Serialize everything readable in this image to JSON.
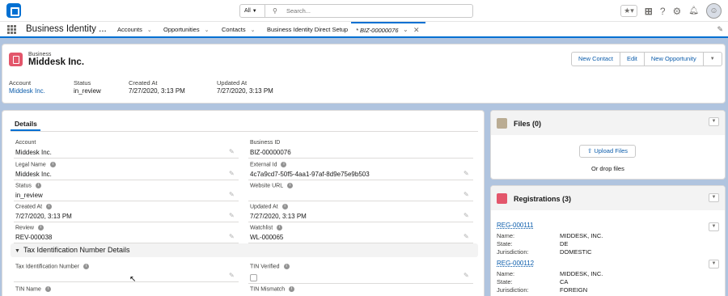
{
  "header": {
    "search_scope": "All",
    "search_placeholder": "Search..."
  },
  "nav": {
    "app_name": "Business Identity ...",
    "items": [
      {
        "label": "Accounts"
      },
      {
        "label": "Opportunities"
      },
      {
        "label": "Contacts"
      },
      {
        "label": "Business Identity Direct Setup"
      }
    ],
    "active_tab": "* BIZ-00000076"
  },
  "record": {
    "object_label": "Business",
    "name": "Middesk Inc.",
    "actions": [
      "New Contact",
      "Edit",
      "New Opportunity"
    ],
    "highlights": [
      {
        "label": "Account",
        "value": "Middesk Inc."
      },
      {
        "label": "Status",
        "value": "in_review"
      },
      {
        "label": "Created At",
        "value": "7/27/2020, 3:13 PM"
      },
      {
        "label": "Updated At",
        "value": "7/27/2020, 3:13 PM"
      }
    ]
  },
  "details": {
    "tab_label": "Details",
    "fields": [
      {
        "label": "Account",
        "value": "Middesk Inc."
      },
      {
        "label": "Business ID",
        "value": "BIZ-00000076"
      },
      {
        "label": "Legal Name",
        "value": "Middesk Inc."
      },
      {
        "label": "External Id",
        "value": "4c7a9cd7-50f5-4aa1-97af-8d9e75e9b503"
      },
      {
        "label": "Status",
        "value": "in_review"
      },
      {
        "label": "Website URL",
        "value": ""
      },
      {
        "label": "Created At",
        "value": "7/27/2020, 3:13 PM"
      },
      {
        "label": "Updated At",
        "value": "7/27/2020, 3:13 PM"
      },
      {
        "label": "Review",
        "value": "REV-000038"
      },
      {
        "label": "Watchlist",
        "value": "WL-000065"
      }
    ],
    "section_title": "Tax Identification Number Details",
    "tin_fields": [
      {
        "label": "Tax Identification Number"
      },
      {
        "label": "TIN Verified"
      },
      {
        "label": "TIN Name"
      },
      {
        "label": "TIN Mismatch"
      }
    ]
  },
  "files": {
    "title": "Files (0)",
    "upload_label": "Upload Files",
    "drop_label": "Or drop files"
  },
  "registrations": {
    "title": "Registrations (3)",
    "field_labels": {
      "name": "Name:",
      "state": "State:",
      "jurisdiction": "Jurisdiction:"
    },
    "items": [
      {
        "id": "REG-000111",
        "name": "MIDDESK, INC.",
        "state": "DE",
        "jurisdiction": "DOMESTIC"
      },
      {
        "id": "REG-000112",
        "name": "MIDDESK, INC.",
        "state": "CA",
        "jurisdiction": "FOREIGN"
      }
    ]
  },
  "colors": {
    "brand": "#0070d2",
    "business_icon": "#e3566b",
    "files_icon": "#baac93",
    "link": "#0b5cab",
    "background": "#b0c4df"
  }
}
